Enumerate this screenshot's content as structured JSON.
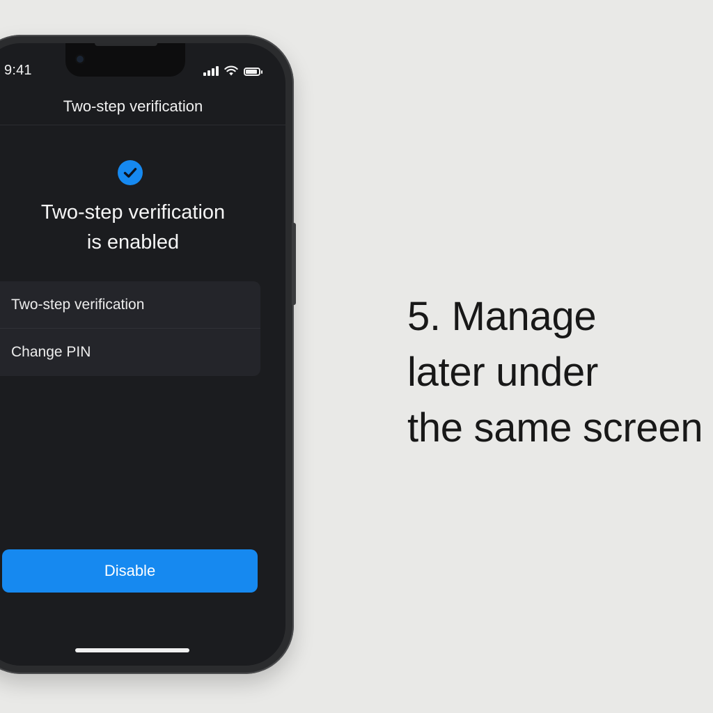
{
  "status_bar": {
    "time": "9:41",
    "battery_level": 0.9
  },
  "nav": {
    "title": "Two-step verification"
  },
  "status": {
    "icon": "check-circle-icon",
    "headline_line1": "Two-step verification",
    "headline_line2": "is enabled"
  },
  "settings": {
    "items": [
      {
        "label": "Two-step verification"
      },
      {
        "label": "Change PIN"
      }
    ]
  },
  "actions": {
    "disable_label": "Disable"
  },
  "caption": {
    "line1": "5. Manage",
    "line2": "later under",
    "line3": "the same screen"
  },
  "colors": {
    "accent": "#1689f0",
    "screen_bg": "#1b1c1f",
    "page_bg": "#e9e9e7"
  }
}
